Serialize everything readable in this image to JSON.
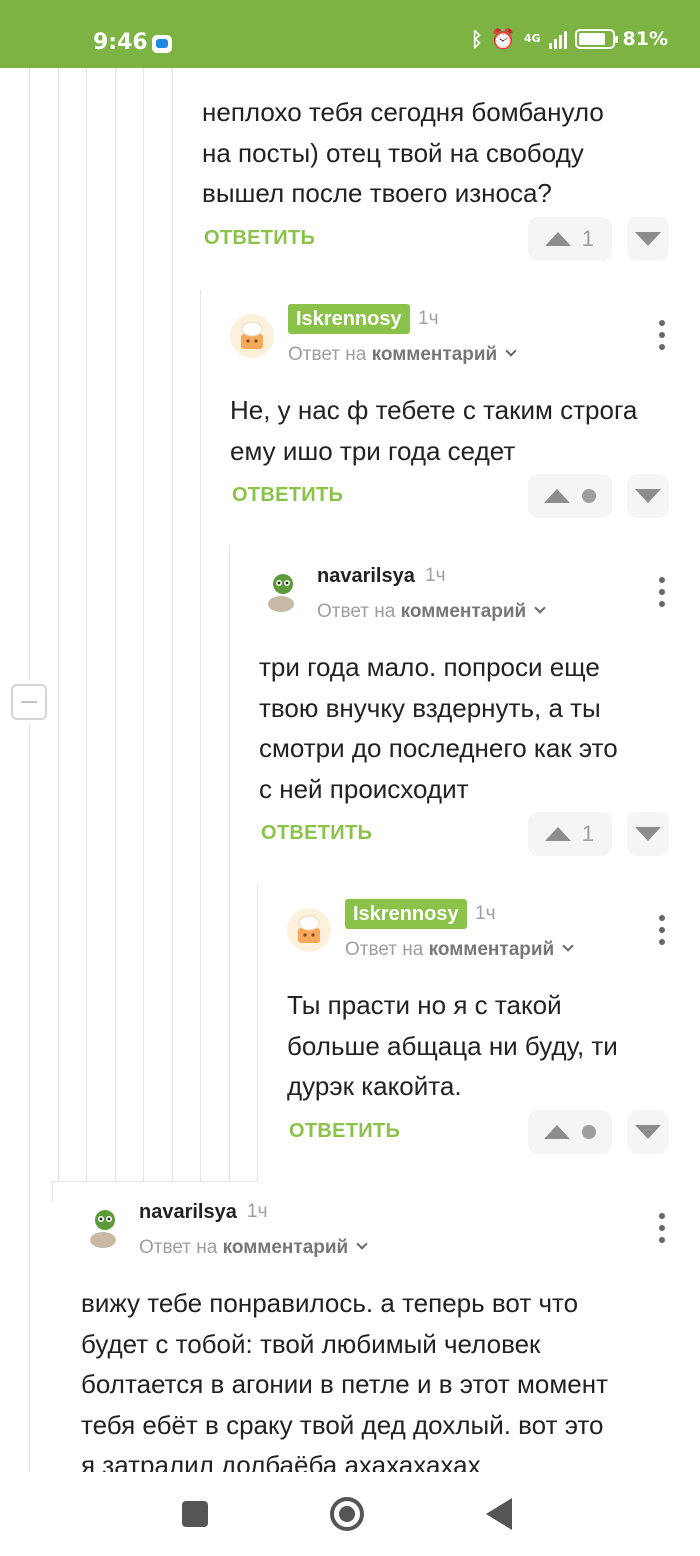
{
  "status_bar": {
    "time": "9:46",
    "network": "4G",
    "battery": "81%"
  },
  "comments": [
    {
      "text_lines": [
        "неплохо тебя сегодня бомбануло",
        "на посты) отец твой на свободу",
        "вышел после твоего износа?"
      ],
      "reply_label": "ОТВЕТИТЬ",
      "rating": "1"
    },
    {
      "username": "Iskrennosy",
      "time": "1ч",
      "reply_prefix": "Ответ на",
      "reply_link": "комментарий",
      "text_lines": [
        "Не, у нас ф тебете с таким строга",
        "ему ишо три года седет"
      ],
      "reply_label": "ОТВЕТИТЬ",
      "rating": ""
    },
    {
      "username": "navarilsya",
      "time": "1ч",
      "reply_prefix": "Ответ на",
      "reply_link": "комментарий",
      "text_lines": [
        "три года мало. попроси еще",
        "твою внучку вздернуть, а ты",
        "смотри до последнего как это",
        "с ней происходит"
      ],
      "reply_label": "ОТВЕТИТЬ",
      "rating": "1"
    },
    {
      "username": "Iskrennosy",
      "time": "1ч",
      "reply_prefix": "Ответ на",
      "reply_link": "комментарий",
      "text_lines": [
        "Ты прасти но я с такой",
        "больше абщаца ни буду, ти",
        "дурэк какойта."
      ],
      "reply_label": "ОТВЕТИТЬ",
      "rating": ""
    },
    {
      "username": "navarilsya",
      "time": "1ч",
      "reply_prefix": "Ответ на",
      "reply_link": "комментарий",
      "text_lines": [
        "вижу тебе понравилось. а теперь вот что",
        "будет с тобой: твой любимый человек",
        "болтается в агонии в петле и в этот момент",
        "тебя ебёт в сраку твой дед дохлый. вот это",
        "я затралил долбаёба ахахахахах"
      ]
    }
  ],
  "icons": {
    "upvote": "arrow-up-icon",
    "downvote": "arrow-down-icon",
    "more": "more-vertical-icon",
    "collapse": "collapse-minus-icon"
  },
  "colors": {
    "status_bar": "#7cb342",
    "accent": "#8bc34a",
    "text": "#222222",
    "muted": "#9e9e9e"
  }
}
